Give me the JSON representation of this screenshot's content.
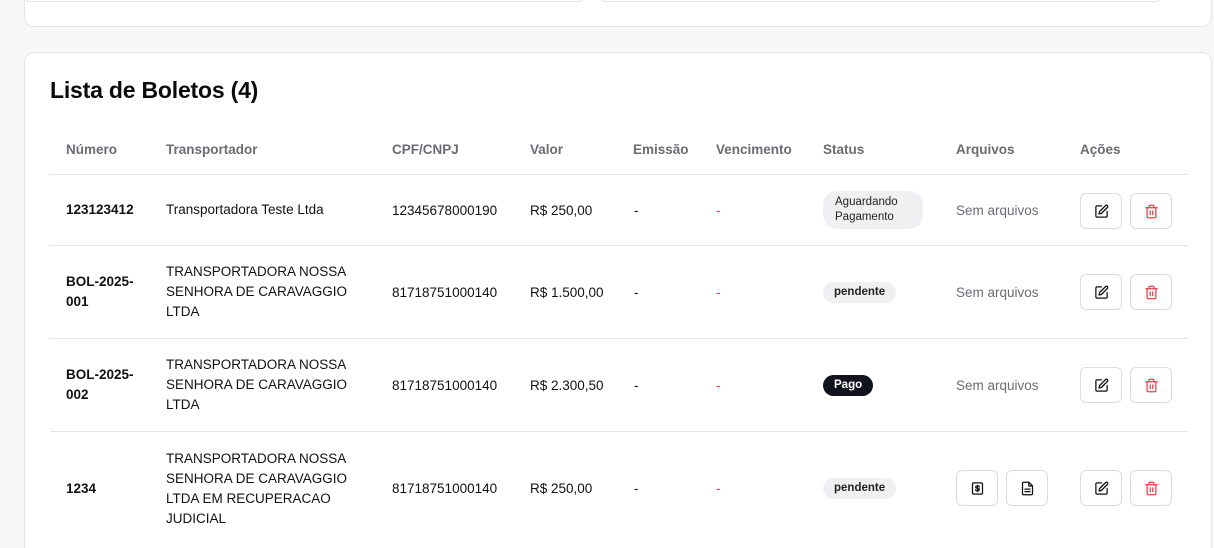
{
  "table": {
    "title": "Lista de Boletos (4)",
    "columns": [
      "Número",
      "Transportador",
      "CPF/CNPJ",
      "Valor",
      "Emissão",
      "Vencimento",
      "Status",
      "Arquivos",
      "Ações"
    ],
    "rows": [
      {
        "numero": "123123412",
        "transportador": "Transportadora Teste Ltda",
        "cnpj": "12345678000190",
        "valor": "R$ 250,00",
        "emissao": "-",
        "vencimento": "-",
        "status": "Aguardando Pagamento",
        "arquivos": "Sem arquivos"
      },
      {
        "numero": "BOL-2025-001",
        "transportador": "TRANSPORTADORA NOSSA SENHORA DE CARAVAGGIO LTDA",
        "cnpj": "81718751000140",
        "valor": "R$ 1.500,00",
        "emissao": "-",
        "vencimento": "-",
        "status": "pendente",
        "arquivos": "Sem arquivos"
      },
      {
        "numero": "BOL-2025-002",
        "transportador": "TRANSPORTADORA NOSSA SENHORA DE CARAVAGGIO LTDA",
        "cnpj": "81718751000140",
        "valor": "R$ 2.300,50",
        "emissao": "-",
        "vencimento": "-",
        "status": "Pago",
        "arquivos": "Sem arquivos"
      },
      {
        "numero": "1234",
        "transportador": "TRANSPORTADORA NOSSA SENHORA DE CARAVAGGIO LTDA EM RECUPERACAO JUDICIAL",
        "cnpj": "81718751000140",
        "valor": "R$ 250,00",
        "emissao": "-",
        "vencimento": "-",
        "status": "pendente",
        "arquivos": ""
      }
    ]
  },
  "icons": {
    "edit": "edit-icon",
    "delete": "trash-icon",
    "boleto_file": "dollar-file-icon",
    "document_file": "document-icon"
  },
  "colors": {
    "danger": "#e0424a",
    "status_dark": "#11141f",
    "status_light": "#f0f0f2",
    "muted_text": "#6b6b74"
  }
}
